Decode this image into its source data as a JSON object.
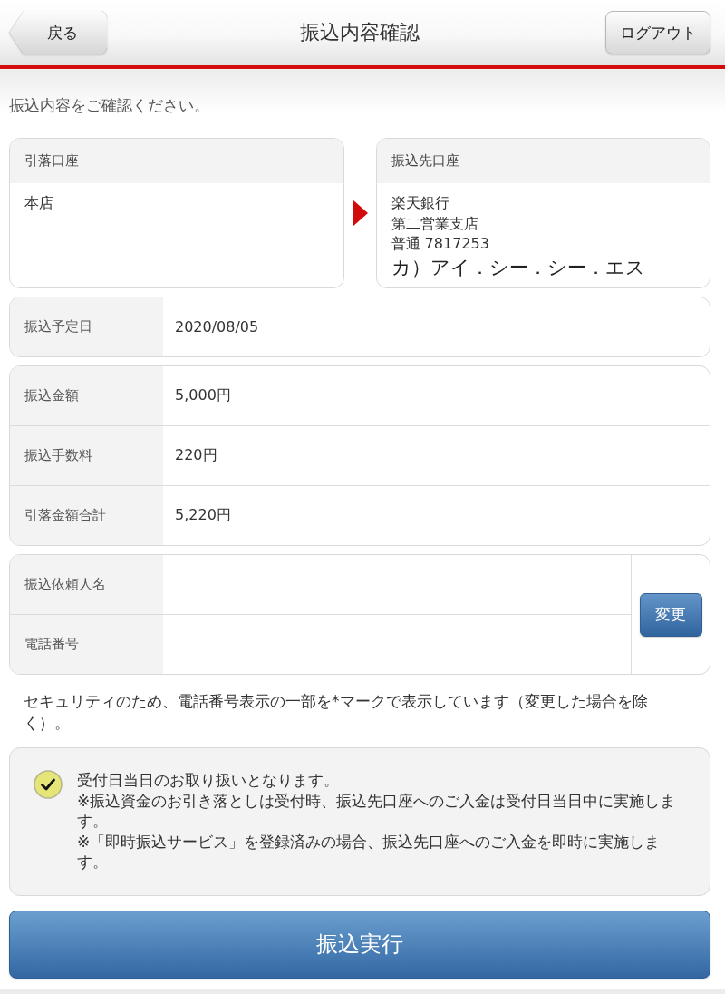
{
  "header": {
    "back_button": "戻る",
    "title": "振込内容確認",
    "logout_button": "ログアウト"
  },
  "intro": "振込内容をご確認ください。",
  "accounts": {
    "source": {
      "heading": "引落口座",
      "lines": [
        "本店"
      ]
    },
    "destination": {
      "heading": "振込先口座",
      "lines": [
        "楽天銀行",
        "第二営業支店",
        "普通 7817253"
      ],
      "holder": "カ）アイ．シー．シー．エス"
    }
  },
  "schedule": {
    "rows": [
      {
        "label": "振込予定日",
        "value": "2020/08/05"
      }
    ]
  },
  "amounts": {
    "rows": [
      {
        "label": "振込金額",
        "value": "5,000円"
      },
      {
        "label": "振込手数料",
        "value": "220円"
      },
      {
        "label": "引落金額合計",
        "value": "5,220円"
      }
    ]
  },
  "requester": {
    "rows": [
      {
        "label": "振込依頼人名"
      },
      {
        "label": "電話番号"
      }
    ],
    "change_button": "変更"
  },
  "security_note": "セキュリティのため、電話番号表示の一部を*マークで表示しています（変更した場合を除く）。",
  "confirmation": {
    "checked": true,
    "lines": [
      "受付日当日のお取り扱いとなります。",
      "※振込資金のお引き落としは受付時、振込先口座へのご入金は受付日当日中に実施します。",
      "※「即時振込サービス」を登録済みの場合、振込先口座へのご入金を即時に実施します。"
    ]
  },
  "execute_button": "振込実行"
}
